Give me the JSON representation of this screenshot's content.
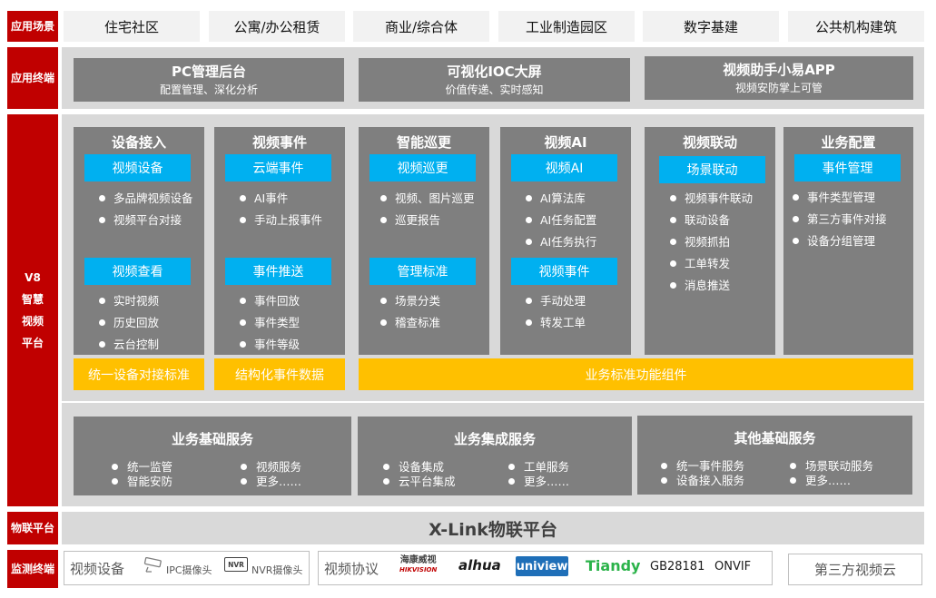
{
  "labels": {
    "app_scene": "应用场景",
    "app_terminal": "应用终端",
    "platform": [
      "V8",
      "智慧",
      "视频",
      "平台"
    ],
    "iot_platform": "物联平台",
    "monitor_terminal": "监测终端"
  },
  "scenes": [
    "住宅社区",
    "公寓/办公租赁",
    "商业/综合体",
    "工业制造园区",
    "数字基建",
    "公共机构建筑"
  ],
  "terminals": [
    {
      "title": "PC管理后台",
      "sub": "配置管理、深化分析"
    },
    {
      "title": "可视化IOC大屏",
      "sub": "价值传递、实时感知"
    },
    {
      "title": "视频助手小易APP",
      "sub": "视频安防掌上可管"
    }
  ],
  "columns": [
    {
      "title": "设备接入",
      "groups": [
        {
          "label": "视频设备",
          "items": [
            "多品牌视频设备",
            "视频平台对接"
          ]
        },
        {
          "label": "视频查看",
          "items": [
            "实时视频",
            "历史回放",
            "云台控制"
          ]
        }
      ]
    },
    {
      "title": "视频事件",
      "groups": [
        {
          "label": "云端事件",
          "items": [
            "AI事件",
            "手动上报事件"
          ]
        },
        {
          "label": "事件推送",
          "items": [
            "事件回放",
            "事件类型",
            "事件等级"
          ]
        }
      ]
    },
    {
      "title": "智能巡更",
      "groups": [
        {
          "label": "视频巡更",
          "items": [
            "视频、图片巡更",
            "巡更报告"
          ]
        },
        {
          "label": "管理标准",
          "items": [
            "场景分类",
            "稽查标准"
          ]
        }
      ]
    },
    {
      "title": "视频AI",
      "groups": [
        {
          "label": "视频AI",
          "items": [
            "AI算法库",
            "AI任务配置",
            "AI任务执行"
          ]
        },
        {
          "label": "视频事件",
          "items": [
            "手动处理",
            "转发工单"
          ]
        }
      ]
    },
    {
      "title": "视频联动",
      "groups": [
        {
          "label": "场景联动",
          "items": [
            "视频事件联动",
            "联动设备",
            "视频抓拍",
            "工单转发",
            "消息推送"
          ]
        }
      ]
    },
    {
      "title": "业务配置",
      "groups": [
        {
          "label": "事件管理",
          "items": [
            "事件类型管理",
            "第三方事件对接",
            "设备分组管理"
          ]
        }
      ]
    }
  ],
  "yellow_bars": [
    "统一设备对接标准",
    "结构化事件数据",
    "业务标准功能组件"
  ],
  "services": [
    {
      "title": "业务基础服务",
      "items": [
        "统一监管",
        "视频服务",
        "智能安防",
        "更多……"
      ]
    },
    {
      "title": "业务集成服务",
      "items": [
        "设备集成",
        "工单服务",
        "云平台集成",
        "更多……"
      ]
    },
    {
      "title": "其他基础服务",
      "items": [
        "统一事件服务",
        "场景联动服务",
        "设备接入服务",
        "更多……"
      ]
    }
  ],
  "xlink": "X-Link物联平台",
  "bottom": {
    "video_device": "视频设备",
    "ipc": "IPC摄像头",
    "nvr_logo": "NVR",
    "nvr": "NVR摄像头",
    "video_protocol": "视频协议",
    "hik_cn": "海康威视",
    "hik_en": "HIKVISION",
    "dahua": "alhua",
    "uniview": "uniview",
    "tiandy": "Tiandy",
    "gb": "GB28181",
    "onvif": "ONVIF",
    "third_party": "第三方视频云"
  },
  "colors": {
    "red": "#c00000",
    "gray": "#7f7f7f",
    "band": "#d9d9d9",
    "blue": "#00b0f0",
    "yellow": "#ffc000"
  }
}
